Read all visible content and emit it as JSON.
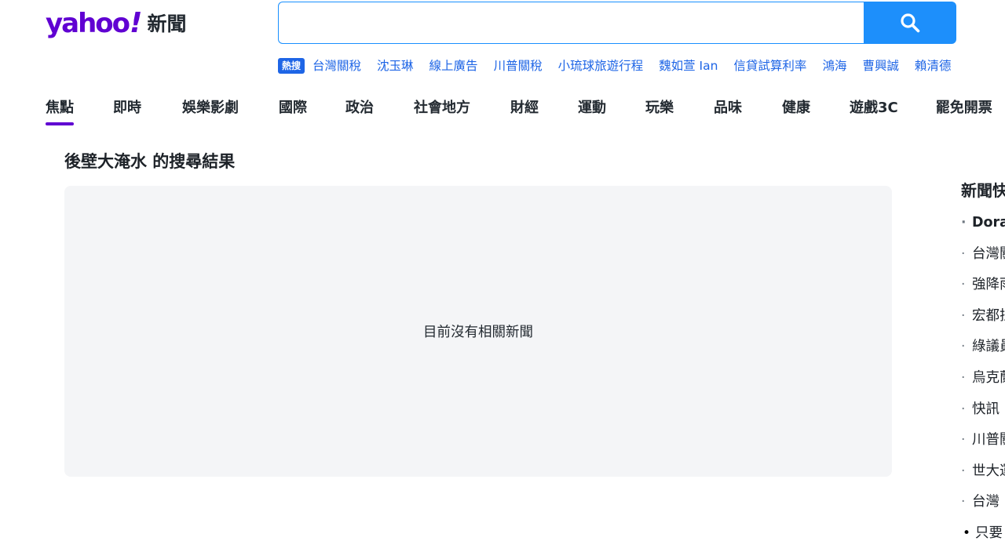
{
  "header": {
    "logo_text": "yahoo",
    "logo_bang": "!",
    "logo_sub": "新聞"
  },
  "search": {
    "value": "",
    "placeholder": "",
    "button_icon": "search-icon"
  },
  "trending": {
    "badge": "熱搜",
    "links": [
      "台灣關稅",
      "沈玉琳",
      "線上廣告",
      "川普關稅",
      "小琉球旅遊行程",
      "魏如萱 Ian",
      "信貸試算利率",
      "鴻海",
      "曹興誠",
      "賴清德"
    ]
  },
  "nav": {
    "items": [
      "焦點",
      "即時",
      "娛樂影劇",
      "國際",
      "政治",
      "社會地方",
      "財經",
      "運動",
      "玩樂",
      "品味",
      "健康",
      "遊戲3C",
      "罷免開票"
    ],
    "active_index": 0
  },
  "results": {
    "title": "後壁大淹水 的搜尋結果",
    "empty_message": "目前沒有相關新聞"
  },
  "sidebar": {
    "title": "新聞快訊",
    "items": [
      "Doraemon",
      "台灣關稅",
      "強降雨",
      "宏都拉斯",
      "綠議員",
      "烏克蘭",
      "快訊",
      "川普關稅",
      "世大運",
      "台灣",
      "只要"
    ]
  },
  "colors": {
    "brand": "#6001d2",
    "search_button": "#1d8ffb",
    "link": "#1e65e6",
    "panel_bg": "#f4f5f7"
  }
}
